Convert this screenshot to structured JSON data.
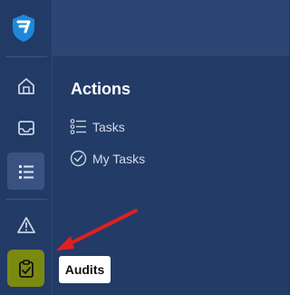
{
  "sidebar": {
    "items": [
      {
        "icon": "home-icon"
      },
      {
        "icon": "inbox-icon"
      },
      {
        "icon": "list-icon",
        "active": true
      },
      {
        "icon": "warning-icon"
      },
      {
        "icon": "clipboard-check-icon",
        "highlighted": true
      }
    ]
  },
  "panel": {
    "title": "Actions",
    "items": [
      {
        "label": "Tasks",
        "icon": "list-bullets-icon"
      },
      {
        "label": "My Tasks",
        "icon": "check-circle-icon"
      }
    ]
  },
  "tooltip": {
    "text": "Audits"
  },
  "colors": {
    "accent": "#7a8a10",
    "panel": "#233b67",
    "arrow": "#e02020"
  }
}
